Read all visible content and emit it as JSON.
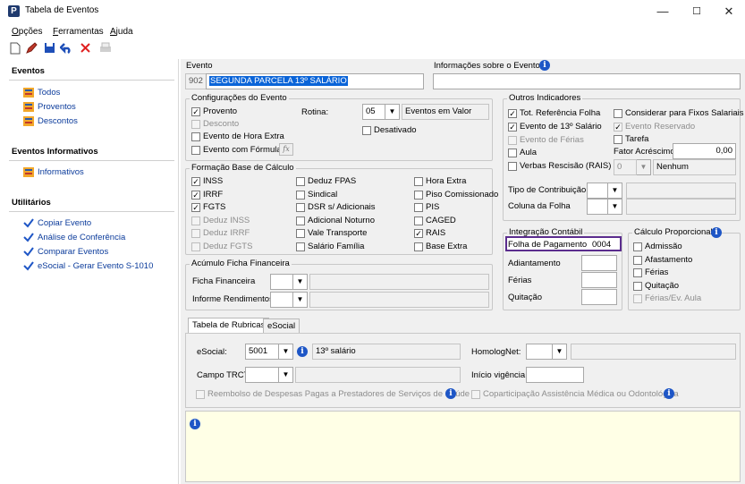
{
  "window": {
    "title": "Tabela de Eventos",
    "min": "—",
    "max": "☐",
    "close": "✕",
    "app_letter": "P"
  },
  "menu": {
    "items": [
      {
        "u": "O",
        "rest": "pções"
      },
      {
        "u": "F",
        "rest": "erramentas"
      },
      {
        "u": "A",
        "rest": "juda"
      }
    ]
  },
  "sidebar": {
    "sections": [
      {
        "title": "Eventos",
        "items": [
          "Todos",
          "Proventos",
          "Descontos"
        ]
      },
      {
        "title": "Eventos Informativos",
        "items": [
          "Informativos"
        ]
      },
      {
        "title": "Utilitários",
        "items": [
          "Copiar Evento",
          "Análise de Conferência",
          "Comparar Eventos",
          "eSocial - Gerar Evento S-1010"
        ]
      }
    ]
  },
  "evento": {
    "label": "Evento",
    "code": "902",
    "name": "SEGUNDA PARCELA 13º SALÁRIO",
    "info_label": "Informações sobre o Evento",
    "info_value": ""
  },
  "config": {
    "title": "Configurações do Evento",
    "checks": [
      {
        "label": "Provento",
        "checked": true,
        "disabled": false
      },
      {
        "label": "Desconto",
        "checked": false,
        "disabled": true
      },
      {
        "label": "Evento de Hora Extra",
        "checked": false,
        "disabled": false
      },
      {
        "label": "Evento com Fórmula",
        "checked": false,
        "disabled": false
      }
    ],
    "rotina_label": "Rotina:",
    "rotina_value": "05",
    "rotina_desc": "Eventos em Valor",
    "desativado": "Desativado",
    "fx": "fx"
  },
  "formacao": {
    "title": "Formação Base de Cálculo",
    "col1": [
      {
        "label": "INSS",
        "checked": true,
        "disabled": false
      },
      {
        "label": "IRRF",
        "checked": true,
        "disabled": false
      },
      {
        "label": "FGTS",
        "checked": true,
        "disabled": false
      },
      {
        "label": "Deduz INSS",
        "checked": false,
        "disabled": true
      },
      {
        "label": "Deduz IRRF",
        "checked": false,
        "disabled": true
      },
      {
        "label": "Deduz FGTS",
        "checked": false,
        "disabled": true
      }
    ],
    "col2": [
      {
        "label": "Deduz FPAS",
        "checked": false
      },
      {
        "label": "Sindical",
        "checked": false
      },
      {
        "label": "DSR s/ Adicionais",
        "checked": false
      },
      {
        "label": "Adicional Noturno",
        "checked": false
      },
      {
        "label": "Vale Transporte",
        "checked": false
      },
      {
        "label": "Salário Família",
        "checked": false
      }
    ],
    "col3": [
      {
        "label": "Hora Extra",
        "checked": false
      },
      {
        "label": "Piso Comissionado",
        "checked": false
      },
      {
        "label": "PIS",
        "checked": false
      },
      {
        "label": "CAGED",
        "checked": false
      },
      {
        "label": "RAIS",
        "checked": true
      },
      {
        "label": "Base Extra",
        "checked": false
      }
    ]
  },
  "acumulo": {
    "title": "Acúmulo Ficha Financeira",
    "ficha_label": "Ficha Financeira",
    "informe_label": "Informe Rendimentos"
  },
  "outros": {
    "title": "Outros Indicadores",
    "left": [
      {
        "label": "Tot. Referência Folha",
        "checked": true,
        "disabled": false
      },
      {
        "label": "Evento de 13º Salário",
        "checked": true,
        "disabled": false
      },
      {
        "label": "Evento de Férias",
        "checked": false,
        "disabled": true
      },
      {
        "label": "Aula",
        "checked": false,
        "disabled": false
      },
      {
        "label": "Verbas Rescisão (RAIS)",
        "checked": false,
        "disabled": false
      }
    ],
    "right": [
      {
        "label": "Considerar para Fixos Salariais",
        "checked": false,
        "disabled": false
      },
      {
        "label": "Evento Reservado",
        "checked": true,
        "disabled": true
      },
      {
        "label": "Tarefa",
        "checked": false,
        "disabled": false
      }
    ],
    "fator_label": "Fator Acréscimo",
    "fator_value": "0,00",
    "nenhum_code": "0",
    "nenhum": "Nenhum",
    "tipo_label": "Tipo de Contribuição",
    "coluna_label": "Coluna da Folha"
  },
  "integracao": {
    "title": "Integração Contábil",
    "folha_label": "Folha de Pagamento",
    "folha_value": "0004",
    "adiant": "Adiantamento",
    "ferias": "Férias",
    "quitacao": "Quitação"
  },
  "proporcional": {
    "title": "Cálculo Proporcional",
    "items": [
      {
        "label": "Admissão",
        "disabled": false
      },
      {
        "label": "Afastamento",
        "disabled": false
      },
      {
        "label": "Férias",
        "disabled": false
      },
      {
        "label": "Quitação",
        "disabled": false
      },
      {
        "label": "Férias/Ev. Aula",
        "disabled": true
      }
    ]
  },
  "tabs": [
    "Tabela de Rubricas",
    "eSocial"
  ],
  "rubricas": {
    "esocial_label": "eSocial:",
    "esocial_value": "5001",
    "esocial_desc": "13º salário",
    "homolog_label": "HomologNet:",
    "trct_label": "Campo TRCT:",
    "inicio_label": "Início vigência:",
    "reembolso": "Reembolso de Despesas Pagas a Prestadores de Serviços de Saúde",
    "copart": "Coparticipação Assistência Médica ou Odontológica"
  },
  "colors": {
    "accent": "#1e56c6",
    "highlight_border": "#5b2d8e",
    "note_bg": "#ffffe6",
    "selection": "#0a64d8"
  }
}
